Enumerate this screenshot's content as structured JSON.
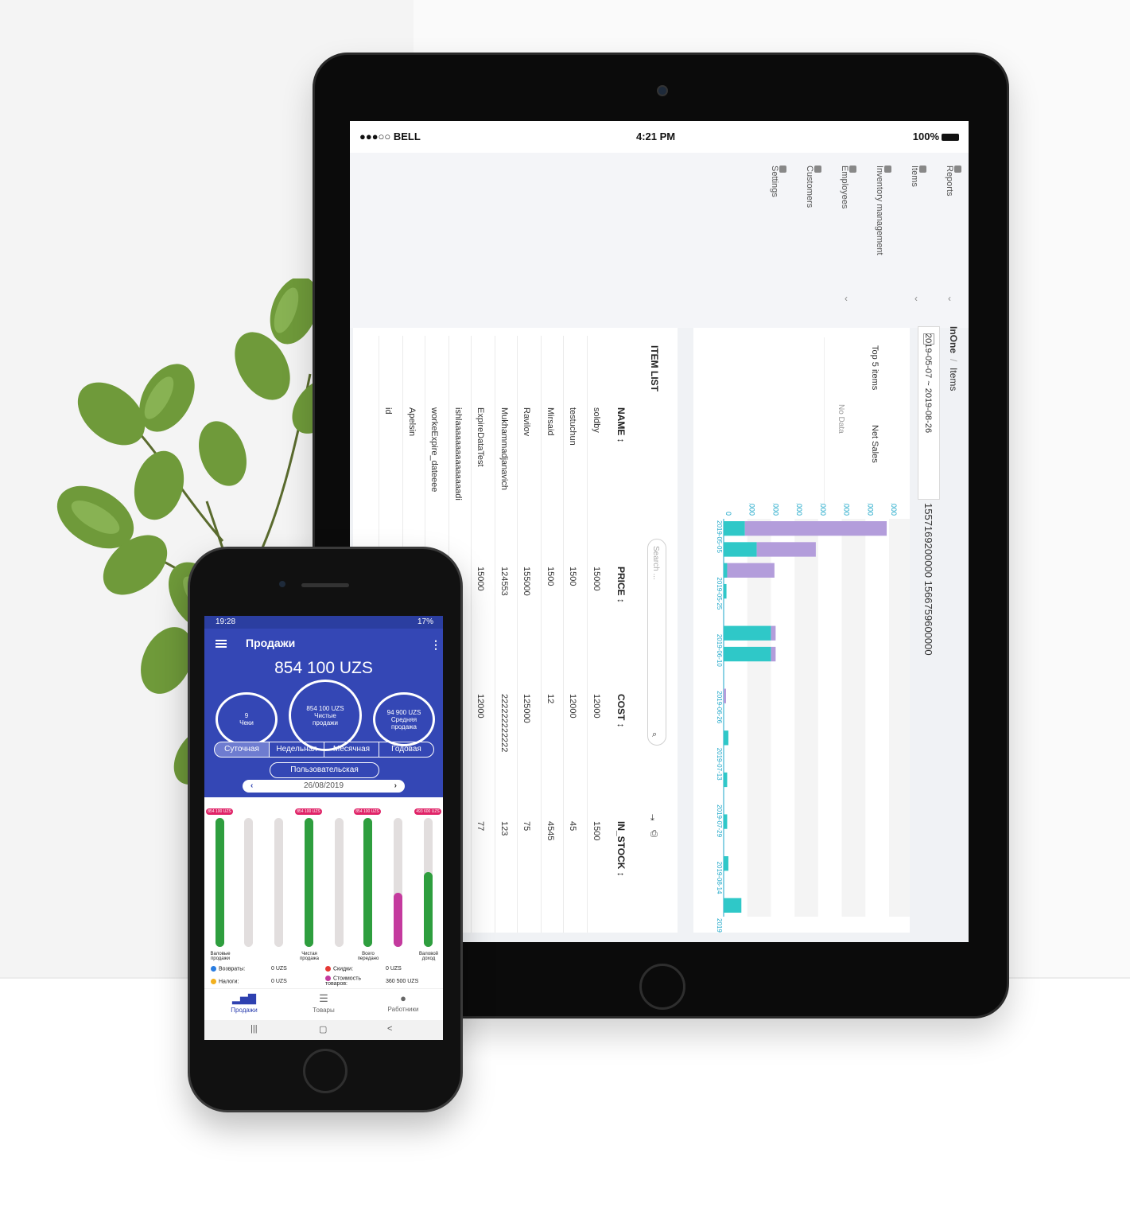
{
  "tablet": {
    "status": {
      "carrier": "●●●○○ BELL",
      "time": "4:21 PM",
      "battery": "100%"
    },
    "menu": [
      "Reports",
      "Items",
      "Inventory management",
      "Employees",
      "Customers",
      "Settings"
    ],
    "breadcrumb": {
      "root": "InOne",
      "separator": "/",
      "current": "Items"
    },
    "date_range": "2019-05-07 ~ 2019-08-26",
    "timestamps": "1557169200000 1566759600000",
    "top5": {
      "title": "Top 5 items",
      "column": "Net Sales",
      "empty": "No Data"
    },
    "item_list": {
      "title": "ITEM LIST",
      "search_placeholder": "Search ...",
      "columns": [
        "NAME ↕",
        "PRICE ↕",
        "COST ↕",
        "IN_STOCK ↕"
      ],
      "rows": [
        {
          "name": "soldby",
          "price": "15000",
          "cost": "12000",
          "in_stock": "1500"
        },
        {
          "name": "testuchun",
          "price": "1500",
          "cost": "12000",
          "in_stock": "45"
        },
        {
          "name": "Mirsaid",
          "price": "1500",
          "cost": "12",
          "in_stock": "4545"
        },
        {
          "name": "Ravilov",
          "price": "155000",
          "cost": "125000",
          "in_stock": "75"
        },
        {
          "name": "Mukhammadjanavich",
          "price": "124553",
          "cost": "222222222222",
          "in_stock": "123"
        },
        {
          "name": "ExpireDataTest",
          "price": "15000",
          "cost": "12000",
          "in_stock": "77"
        },
        {
          "name": "ishlaaaaaaaaaaaaaaadi",
          "price": "",
          "cost": "",
          "in_stock": ""
        },
        {
          "name": "workeExpire_dateeee",
          "price": "",
          "cost": "",
          "in_stock": ""
        },
        {
          "name": "Apelsin",
          "price": "",
          "cost": "",
          "in_stock": ""
        },
        {
          "name": "id",
          "price": "",
          "cost": "",
          "in_stock": ""
        }
      ]
    }
  },
  "chart_data": {
    "type": "bar",
    "stacked": true,
    "orientation": "horizontal-rotated",
    "y_ticks": [
      "0",
      "10,000",
      "20,000",
      "30,000",
      "40,000",
      "50,000",
      "60,000",
      "70,000"
    ],
    "ylim": [
      0,
      70000
    ],
    "date_labels": [
      "2019-05-05",
      "2019-05-25",
      "2019-06-10",
      "2019-06-26",
      "2019-07-13",
      "2019-07-29",
      "2019-08-14",
      "2019-08-31"
    ],
    "series": [
      {
        "color": "#2fc8c8",
        "values": [
          9000,
          14000,
          1500,
          1200,
          0,
          20000,
          20000,
          0,
          0,
          0,
          2000,
          0,
          1500,
          0,
          1500,
          0,
          2000,
          0,
          7500
        ]
      },
      {
        "color": "#b39ddb",
        "values": [
          60000,
          25000,
          20000,
          0,
          0,
          2000,
          2000,
          0,
          1000,
          0,
          0,
          0,
          0,
          0,
          0,
          0,
          0,
          0,
          0
        ]
      }
    ]
  },
  "phone": {
    "status": {
      "time": "19:28",
      "right": "17%"
    },
    "title": "Продажи",
    "total": "854 100 UZS",
    "circles": [
      {
        "value": "9",
        "label": "Чеки"
      },
      {
        "value": "854 100 UZS",
        "label": "Чистые продажи"
      },
      {
        "value": "94 900 UZS",
        "label": "Средняя продажа"
      }
    ],
    "tabs": [
      "Суточная",
      "Недельная",
      "Месячная",
      "Годовая"
    ],
    "active_tab": "Суточная",
    "custom": "Пользовательская",
    "date": "26/08/2019",
    "bars": [
      {
        "tag": "854 100 UZS",
        "fill": 1.0,
        "color": "#2e9e3e"
      },
      {
        "tag": "",
        "fill": 0,
        "color": "#2e9e3e"
      },
      {
        "tag": "",
        "fill": 0,
        "color": "#2e9e3e"
      },
      {
        "tag": "854 100 UZS",
        "fill": 1.0,
        "color": "#2e9e3e"
      },
      {
        "tag": "",
        "fill": 0,
        "color": "#2e9e3e"
      },
      {
        "tag": "854 100 UZS",
        "fill": 1.0,
        "color": "#2e9e3e"
      },
      {
        "tag": "",
        "fill": 0.42,
        "color": "#c43a9e"
      },
      {
        "tag": "493 600 UZS",
        "fill": 0.58,
        "color": "#2e9e3e"
      }
    ],
    "bar_labels": [
      "Валовые продажи",
      "Чистая продажа",
      "Всего передано",
      "Валовой доход"
    ],
    "legend": [
      {
        "label": "Возвраты:",
        "value": "0 UZS",
        "color": "#2a7de1"
      },
      {
        "label": "Налоги:",
        "value": "0 UZS",
        "color": "#f2b01e"
      },
      {
        "label": "Скидки:",
        "value": "0 UZS",
        "color": "#e53935"
      },
      {
        "label": "Стоимость товаров:",
        "value": "360 500 UZS",
        "color": "#c43a9e"
      }
    ],
    "nav": [
      "Продажи",
      "Товары",
      "Работники"
    ],
    "android_nav": [
      "|||",
      "▢",
      "<"
    ]
  }
}
